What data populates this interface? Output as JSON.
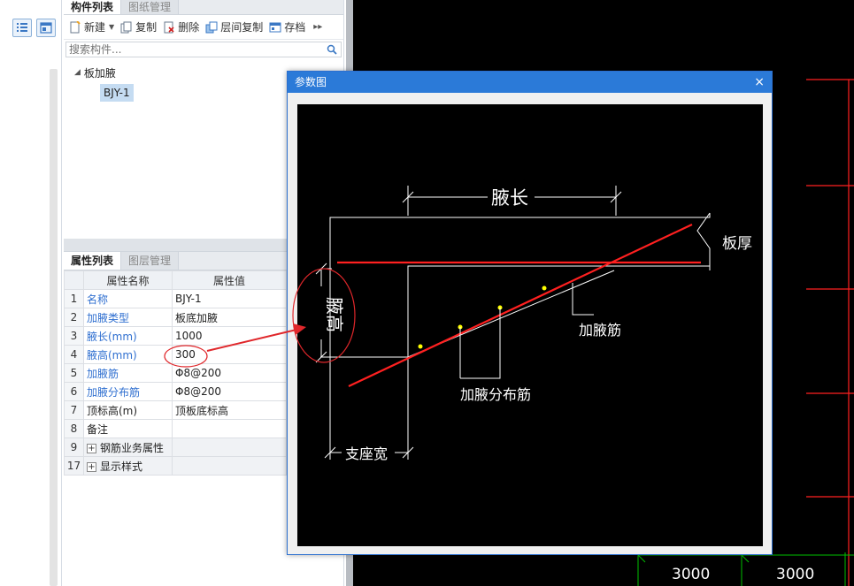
{
  "component_panel": {
    "tabs": [
      "构件列表",
      "图纸管理"
    ],
    "toolbar": {
      "new": "新建",
      "copy": "复制",
      "delete": "删除",
      "floor_copy": "层间复制",
      "archive": "存档"
    },
    "search_placeholder": "搜索构件...",
    "tree": {
      "parent": "板加腋",
      "child": "BJY-1"
    }
  },
  "properties_panel": {
    "tabs": [
      "属性列表",
      "图层管理"
    ],
    "columns": {
      "name": "属性名称",
      "value": "属性值"
    },
    "rows": [
      {
        "num": "1",
        "name": "名称",
        "value": "BJY-1"
      },
      {
        "num": "2",
        "name": "加腋类型",
        "value": "板底加腋"
      },
      {
        "num": "3",
        "name": "腋长(mm)",
        "value": "1000"
      },
      {
        "num": "4",
        "name": "腋高(mm)",
        "value": "300"
      },
      {
        "num": "5",
        "name": "加腋筋",
        "value": "Φ8@200"
      },
      {
        "num": "6",
        "name": "加腋分布筋",
        "value": "Φ8@200"
      },
      {
        "num": "7",
        "name": "顶标高(m)",
        "value": "顶板底标高"
      },
      {
        "num": "8",
        "name": "备注",
        "value": ""
      },
      {
        "num": "9",
        "name": "钢筋业务属性",
        "value": ""
      },
      {
        "num": "17",
        "name": "显示样式",
        "value": ""
      }
    ]
  },
  "dialog": {
    "title": "参数图",
    "close": "×",
    "diagram_labels": {
      "haunch_length": "腋长",
      "slab_thickness": "板厚",
      "haunch_height": "腋高",
      "haunch_rebar": "加腋筋",
      "distribution_rebar": "加腋分布筋",
      "support_width": "支座宽"
    }
  },
  "cad": {
    "dim_left": "3000",
    "dim_right": "3000"
  },
  "colors": {
    "accent": "#2b7ad8",
    "annotation": "#e0272b",
    "cad_red": "#ff2020",
    "cad_green": "#00c000"
  }
}
